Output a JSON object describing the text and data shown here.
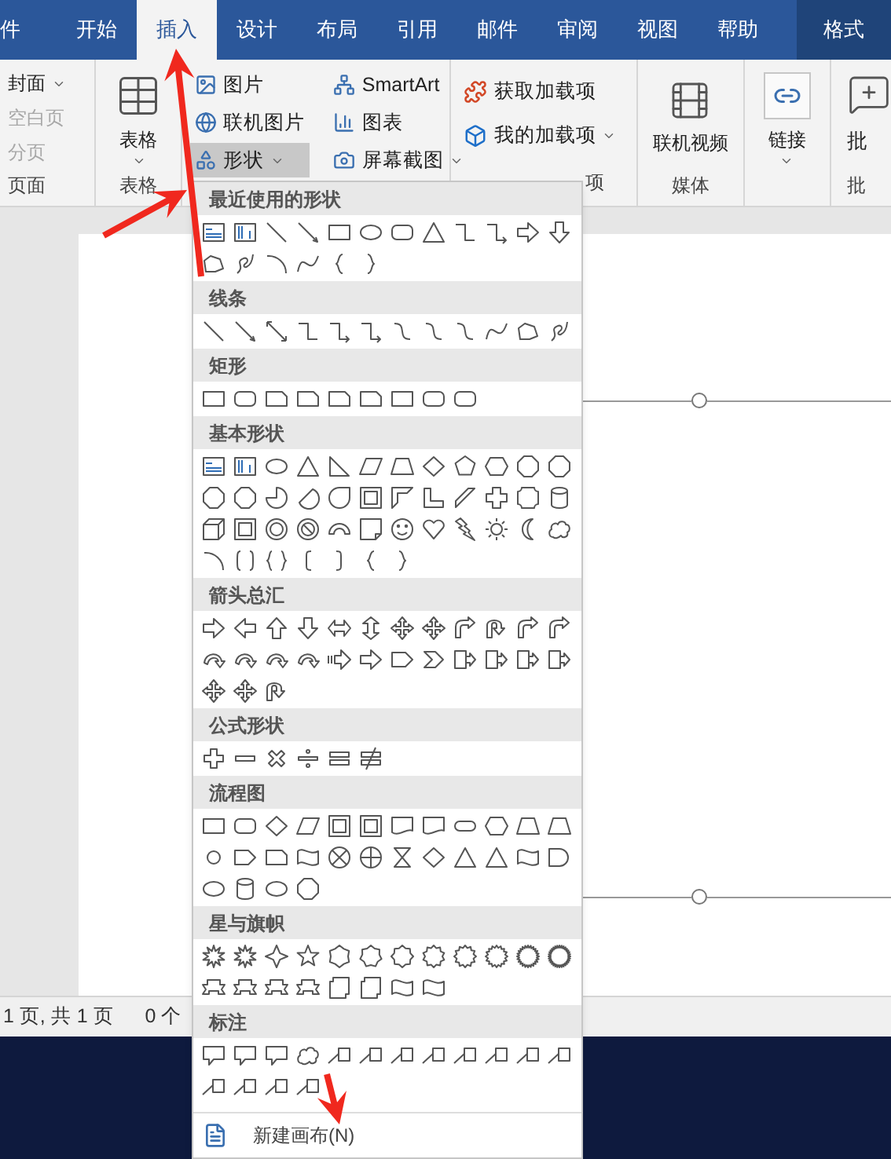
{
  "tabs": [
    {
      "label": "件",
      "selected": false,
      "kind": "normal"
    },
    {
      "label": "开始",
      "selected": false,
      "kind": "normal"
    },
    {
      "label": "插入",
      "selected": true,
      "kind": "normal"
    },
    {
      "label": "设计",
      "selected": false,
      "kind": "normal"
    },
    {
      "label": "布局",
      "selected": false,
      "kind": "normal"
    },
    {
      "label": "引用",
      "selected": false,
      "kind": "normal"
    },
    {
      "label": "邮件",
      "selected": false,
      "kind": "normal"
    },
    {
      "label": "审阅",
      "selected": false,
      "kind": "normal"
    },
    {
      "label": "视图",
      "selected": false,
      "kind": "normal"
    },
    {
      "label": "帮助",
      "selected": false,
      "kind": "normal"
    },
    {
      "label": "格式",
      "selected": false,
      "kind": "contextual"
    }
  ],
  "ribbon": {
    "pages": {
      "items": [
        {
          "label": "封面",
          "disabled": false,
          "dropdown": true
        },
        {
          "label": "空白页",
          "disabled": true,
          "dropdown": false
        },
        {
          "label": "分页",
          "disabled": true,
          "dropdown": false
        }
      ],
      "group_label": "页面"
    },
    "table": {
      "button": "表格",
      "group_label": "表格"
    },
    "illustrations": {
      "items": [
        {
          "label": "图片",
          "pressed": false,
          "dropdown": false
        },
        {
          "label": "联机图片",
          "pressed": false,
          "dropdown": false
        },
        {
          "label": "形状",
          "pressed": true,
          "dropdown": true
        },
        {
          "label": "SmartArt",
          "pressed": false,
          "dropdown": false
        },
        {
          "label": "图表",
          "pressed": false,
          "dropdown": false
        },
        {
          "label": "屏幕截图",
          "pressed": false,
          "dropdown": true
        }
      ]
    },
    "addins": {
      "items": [
        {
          "label": "获取加载项",
          "dropdown": false
        },
        {
          "label": "我的加载项",
          "dropdown": true
        }
      ],
      "group_label": "项"
    },
    "media": {
      "button": "联机视频",
      "group_label": "媒体"
    },
    "links": {
      "button": "链接"
    },
    "comments": {
      "button": "批",
      "group_label": "批"
    }
  },
  "status_bar": [
    "1 页, 共 1 页",
    "0 个"
  ],
  "shapes_menu": {
    "sections": [
      {
        "title": "最近使用的形状"
      },
      {
        "title": "线条"
      },
      {
        "title": "矩形"
      },
      {
        "title": "基本形状"
      },
      {
        "title": "箭头总汇"
      },
      {
        "title": "公式形状"
      },
      {
        "title": "流程图"
      },
      {
        "title": "星与旗帜"
      },
      {
        "title": "标注"
      }
    ],
    "footer": "新建画布(N)"
  }
}
